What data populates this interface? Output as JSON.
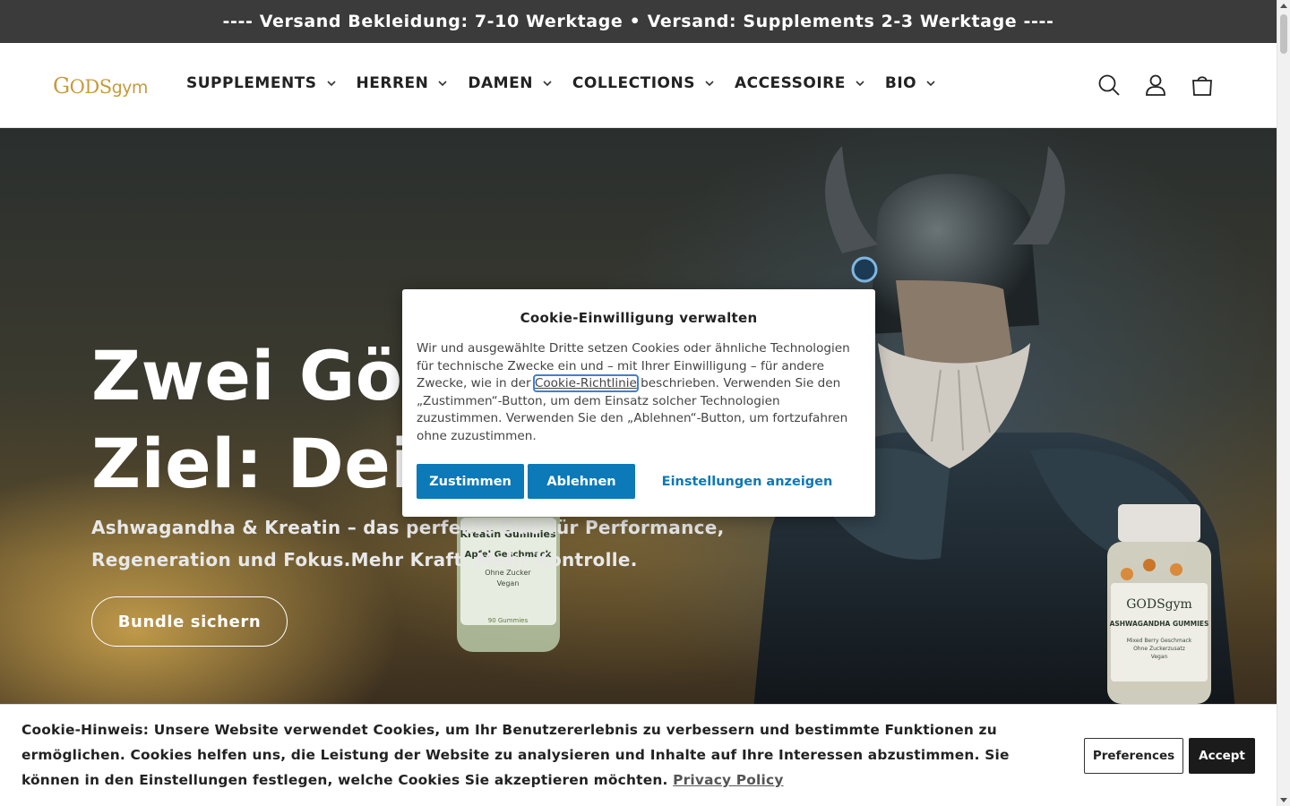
{
  "announcement": {
    "text": "---- Versand Bekleidung: 7-10 Werktage • Versand: Supplements 2-3 Werktage ----"
  },
  "header": {
    "logo": {
      "letter": "G",
      "main": "ODS",
      "suffix": "gym"
    },
    "nav": [
      {
        "label": "SUPPLEMENTS"
      },
      {
        "label": "HERREN"
      },
      {
        "label": "DAMEN"
      },
      {
        "label": "COLLECTIONS"
      },
      {
        "label": "ACCESSOIRE"
      },
      {
        "label": "BIO"
      }
    ],
    "icons": [
      "search-icon",
      "account-icon",
      "cart-icon"
    ]
  },
  "hero": {
    "title_line1": "Zwei Gött",
    "title_line2": "Ziel: Dein",
    "subtitle": "Ashwagandha & Kreatin – das perfekte Duo für Performance, Regeneration und Fokus.Mehr Kraft. Mehr Kontrolle.",
    "button": "Bundle sichern",
    "jar_left": {
      "line1": "Kreatin Gummies",
      "line2": "Apfel Geschmack",
      "line3": "Ohne Zucker",
      "line4": "Vegan",
      "line5": "90 Gummies"
    },
    "jar_right": {
      "brand": "GODSgym",
      "line1": "ASHWAGANDHA GUMMIES",
      "line2": "Mixed Berry Geschmack",
      "line3": "Ohne Zuckerzusatz",
      "line4": "Vegan"
    }
  },
  "cookie_modal": {
    "title": "Cookie-Einwilligung verwalten",
    "body_before": "Wir und ausgewählte Dritte setzen Cookies oder ähnliche Technologien für technische Zwecke ein und – mit Ihrer Einwilligung – für andere Zwecke, wie in der ",
    "policy_link": "Cookie-Richtlinie",
    "body_after": " beschrieben. Verwenden Sie den „Zustimmen“-Button, um dem Einsatz solcher Technologien zuzustimmen. Verwenden Sie den „Ablehnen“-Button, um fortzufahren ohne zuzustimmen.",
    "accept": "Zustimmen",
    "deny": "Ablehnen",
    "settings": "Einstellungen anzeigen"
  },
  "cookie_bar": {
    "text": "Cookie-Hinweis: Unsere Website verwendet Cookies, um Ihr Benutzererlebnis zu verbessern und bestimmte Funktionen zu ermöglichen. Cookies helfen uns, die Leistung der Website zu analysieren und Inhalte auf Ihre Interessen abzustimmen. Sie können in den Einstellungen festlegen, welche Cookies Sie akzeptieren möchten. ",
    "privacy_link": "Privacy Policy",
    "preferences": "Preferences",
    "accept": "Accept"
  },
  "colors": {
    "announcement_bg": "#3b3b3b",
    "logo_gold": "#c79a3b",
    "primary_blue": "#0c79b8",
    "accept_dark": "#1b1b1b"
  }
}
